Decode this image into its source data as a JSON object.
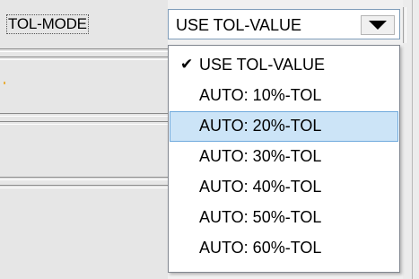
{
  "mode_label": "TOL-MODE",
  "combo": {
    "value": "USE TOL-VALUE",
    "button_icon": "dropdown-arrow-icon"
  },
  "dropdown": {
    "check_icon": "checkmark-icon",
    "checked_index": 0,
    "highlighted_index": 2,
    "options": [
      "USE TOL-VALUE",
      "AUTO: 10%-TOL",
      "AUTO: 20%-TOL",
      "AUTO: 30%-TOL",
      "AUTO: 40%-TOL",
      "AUTO: 50%-TOL",
      "AUTO: 60%-TOL"
    ]
  },
  "colors": {
    "highlight_bg": "#cce4f7",
    "highlight_border": "#6fa9dc",
    "panel_bg": "#e6e6e6"
  }
}
